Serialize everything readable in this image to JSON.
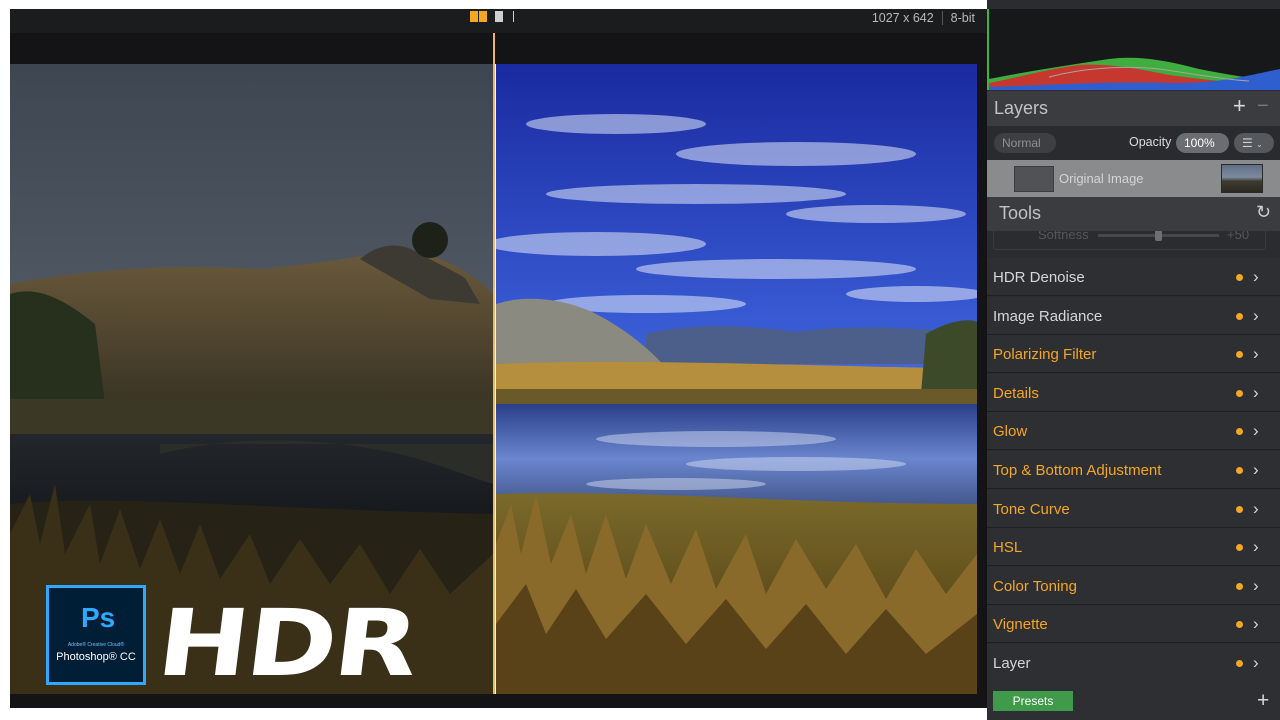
{
  "topbar": {
    "view_icons": [
      "split-view-icon",
      "compare-view-icon"
    ],
    "dimensions": "1027 x 642",
    "bit_depth": "8-bit"
  },
  "overlay": {
    "logo": {
      "mark": "Ps",
      "sub": "Adobe® Creative Cloud®",
      "name": "Photoshop® CC"
    },
    "headline": "HDR"
  },
  "layers": {
    "title": "Layers",
    "add_icon": "+",
    "remove_icon": "−",
    "blend_mode": "Normal",
    "opacity_label": "Opacity",
    "opacity_value": "100%",
    "layer_name": "Original Image"
  },
  "tools": {
    "title": "Tools",
    "softness_label": "Softness",
    "softness_value": "+50",
    "items": [
      {
        "label": "HDR Denoise",
        "color": "#d6d6d6"
      },
      {
        "label": "Image Radiance",
        "color": "#d6d6d6"
      },
      {
        "label": "Polarizing Filter",
        "color": "#f5a623"
      },
      {
        "label": "Details",
        "color": "#f5a623"
      },
      {
        "label": "Glow",
        "color": "#f5a623"
      },
      {
        "label": "Top & Bottom Adjustment",
        "color": "#f5a623"
      },
      {
        "label": "Tone Curve",
        "color": "#f5a623"
      },
      {
        "label": "HSL",
        "color": "#f5a623"
      },
      {
        "label": "Color Toning",
        "color": "#f5a623"
      },
      {
        "label": "Vignette",
        "color": "#f5a623"
      },
      {
        "label": "Layer",
        "color": "#d6d6d6"
      }
    ]
  },
  "footer": {
    "presets_label": "Presets",
    "add_icon": "+"
  },
  "colors": {
    "accent": "#f5a623",
    "active_dot": "#f5a623",
    "presets_green": "#3f9a49",
    "photoshop_blue": "#31a8ff"
  }
}
